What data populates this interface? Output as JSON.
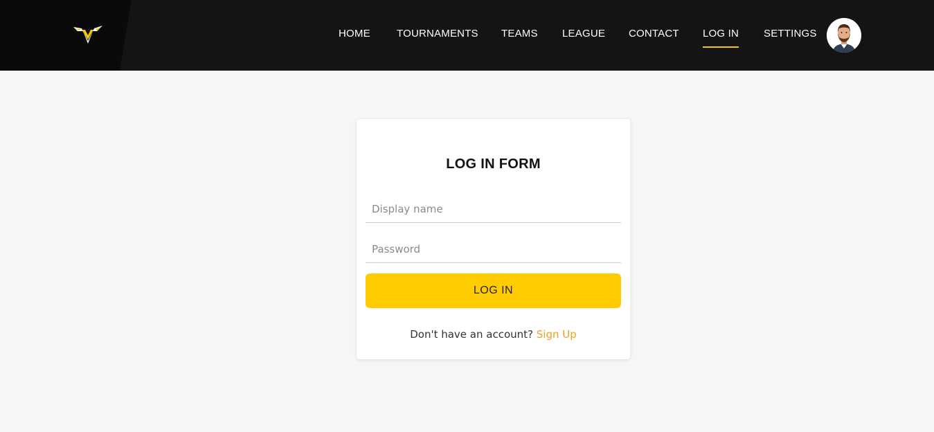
{
  "header": {
    "logo_icon": "winged-v-logo",
    "nav": [
      {
        "label": "HOME",
        "active": false
      },
      {
        "label": "TOURNAMENTS",
        "active": false
      },
      {
        "label": "TEAMS",
        "active": false
      },
      {
        "label": "LEAGUE",
        "active": false
      },
      {
        "label": "CONTACT",
        "active": false
      },
      {
        "label": "LOG IN",
        "active": true
      },
      {
        "label": "SETTINGS",
        "active": false
      }
    ],
    "avatar_icon": "user-avatar"
  },
  "form": {
    "title": "LOG IN FORM",
    "display_name": {
      "placeholder": "Display name",
      "value": ""
    },
    "password": {
      "placeholder": "Password",
      "value": ""
    },
    "submit_label": "LOG IN",
    "signup_prompt": "Don't have an account?",
    "signup_link": "Sign Up"
  },
  "colors": {
    "header_bg": "#141414",
    "accent": "#ffcc00",
    "link": "#f0a020",
    "page_bg": "#f6f6f6"
  }
}
